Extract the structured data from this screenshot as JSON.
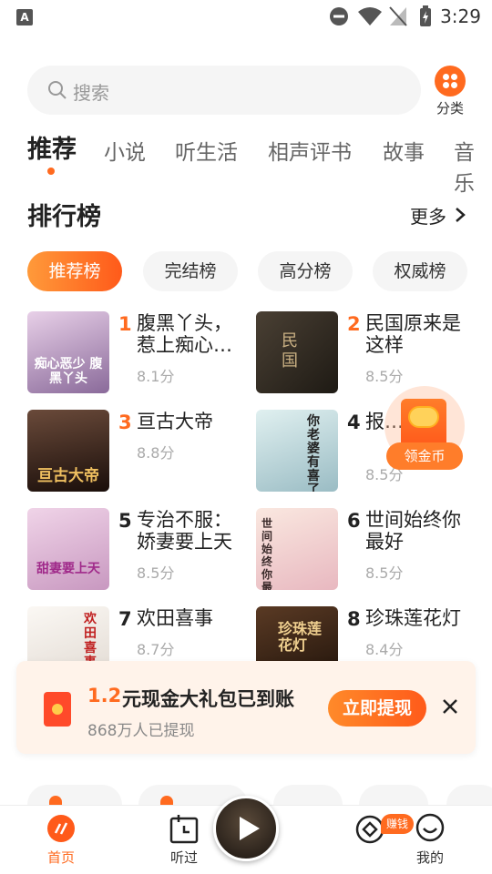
{
  "status_bar": {
    "badge": "A",
    "time": "3:29"
  },
  "search": {
    "placeholder": "搜索"
  },
  "category_button": {
    "label": "分类"
  },
  "top_tabs": [
    "推荐",
    "小说",
    "听生活",
    "相声评书",
    "故事",
    "音乐"
  ],
  "ranking": {
    "title": "排行榜",
    "more": "更多",
    "chips": [
      "推荐榜",
      "完结榜",
      "高分榜",
      "权威榜"
    ],
    "books": [
      {
        "rank": "1",
        "title": "腹黑丫头，惹上痴心…",
        "score": "8.1分",
        "cover_text": "痴心恶少 腹黑丫头",
        "cover_color": "#c8b0d8"
      },
      {
        "rank": "2",
        "title": "民国原来是这样",
        "score": "8.5分",
        "cover_text": "民国",
        "cover_color": "#3a3228"
      },
      {
        "rank": "3",
        "title": "亘古大帝",
        "score": "8.8分",
        "cover_text": "亘古大帝",
        "cover_color": "#2a1a14"
      },
      {
        "rank": "4",
        "title": "报…你…",
        "score": "8.5分",
        "cover_text": "你老婆有喜了",
        "cover_color": "#cfe4e8"
      },
      {
        "rank": "5",
        "title": "专治不服：娇妻要上天",
        "score": "8.5分",
        "cover_text": "甜妻要上天",
        "cover_color": "#e8b8d8"
      },
      {
        "rank": "6",
        "title": "世间始终你最好",
        "score": "8.5分",
        "cover_text": "世间始终你最好",
        "cover_color": "#f4d8d0"
      },
      {
        "rank": "7",
        "title": "欢田喜事",
        "score": "8.7分",
        "cover_text": "欢田喜事",
        "cover_color": "#f0ece8"
      },
      {
        "rank": "8",
        "title": "珍珠莲花灯",
        "score": "8.4分",
        "cover_text": "珍珠莲花灯",
        "cover_color": "#3a2418"
      }
    ]
  },
  "coin_float": {
    "label": "领金币"
  },
  "cash_banner": {
    "amount": "1.2",
    "message": "元现金大礼包已到账",
    "sub": "868万人已提现",
    "cta": "立即提现"
  },
  "bottom_nav": {
    "items": [
      "首页",
      "听过",
      "赚钱",
      "我的"
    ],
    "earn_badge": "赚钱"
  },
  "colors": {
    "accent": "#ff6a1f",
    "banner_bg": "#fff3ea"
  }
}
